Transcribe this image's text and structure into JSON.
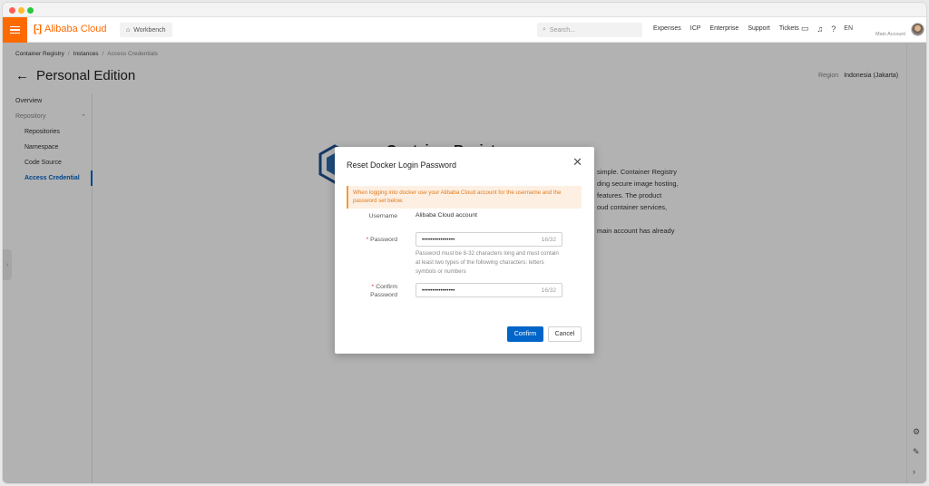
{
  "topnav": {
    "logo_text": "Alibaba Cloud",
    "workbench_label": "Workbench",
    "search_placeholder": "Search...",
    "links": [
      "Expenses",
      "ICP",
      "Enterprise",
      "Support",
      "Tickets"
    ],
    "language": "EN",
    "account_label": "Main Account",
    "accent_color": "#ff6a00"
  },
  "breadcrumb": [
    "Container Registry",
    "Instances",
    "Access Credentials"
  ],
  "page": {
    "title": "Personal Edition",
    "region_label": "Region",
    "region_value": "Indonesia (Jakarta)"
  },
  "sidebar": {
    "overview": "Overview",
    "group": "Repository",
    "items": [
      "Repositories",
      "Namespace",
      "Code Source",
      "Access Credential"
    ],
    "active_index": 3
  },
  "main": {
    "intro_title": "Container Registry",
    "intro_lines": [
      "simple. Container Registry",
      "ding secure image hosting,",
      "features. The product",
      "oud container services,",
      "",
      "main account has already"
    ]
  },
  "dialog": {
    "title": "Reset Docker Login Password",
    "notice": "When logging into docker use your Alibaba Cloud account for the username and the password set below.",
    "username_label": "Username",
    "username_value": "Alibaba Cloud account",
    "password_label": "Password",
    "password_value": "••••••••••••••••",
    "password_count": "16/32",
    "password_hint": "Password must be 8-32 characters long and must contain at least two types of the following characters: letters symbols or numbers",
    "confirm_label_line1": "Confirm",
    "confirm_label_line2": "Password",
    "confirm_value": "••••••••••••••••",
    "confirm_count": "16/32",
    "confirm_button": "Confirm",
    "cancel_button": "Cancel",
    "primary_color": "#0064c8"
  }
}
